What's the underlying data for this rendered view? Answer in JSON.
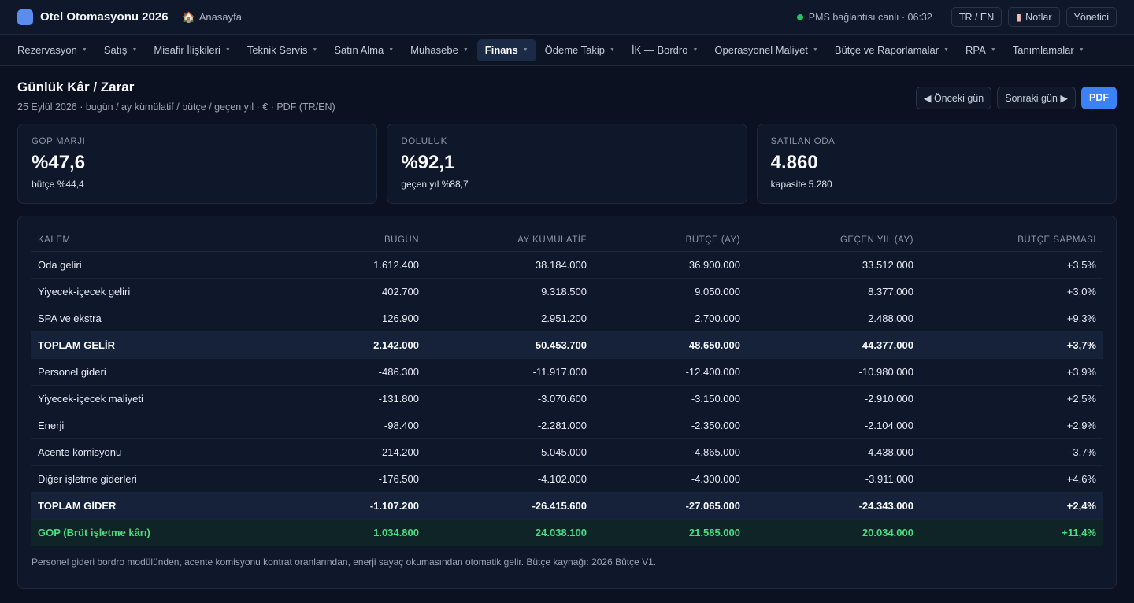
{
  "app": {
    "title": "Otel Otomasyonu 2026",
    "home": "Anasayfa",
    "status": "PMS bağlantısı canlı · 06:32",
    "lang": "TR / EN",
    "notes": "Notlar",
    "user": "Yönetici",
    "accent": "#3b82f6",
    "status_color": "#22c55e"
  },
  "nav": [
    {
      "label": "Rezervasyon"
    },
    {
      "label": "Satış"
    },
    {
      "label": "Misafir İlişkileri"
    },
    {
      "label": "Teknik Servis"
    },
    {
      "label": "Satın Alma"
    },
    {
      "label": "Muhasebe"
    },
    {
      "label": "Finans"
    },
    {
      "label": "Ödeme Takip"
    },
    {
      "label": "İK — Bordro"
    },
    {
      "label": "Operasyonel Maliyet"
    },
    {
      "label": "Bütçe ve Raporlamalar"
    },
    {
      "label": "RPA"
    },
    {
      "label": "Tanımlamalar"
    }
  ],
  "page": {
    "title": "Günlük Kâr / Zarar",
    "subtitle": "25 Eylül 2026 · bugün / ay kümülatif / bütçe / geçen yıl · € · PDF (TR/EN)",
    "prev": "◀ Önceki gün",
    "next": "Sonraki gün ▶",
    "pdf": "PDF"
  },
  "kpis": [
    {
      "label": "GOP MARJI",
      "value": "%47,6",
      "sub": "bütçe %44,4"
    },
    {
      "label": "DOLULUK",
      "value": "%92,1",
      "sub": "geçen yıl %88,7"
    },
    {
      "label": "SATILAN ODA",
      "value": "4.860",
      "sub": "kapasite 5.280"
    }
  ],
  "table": {
    "headers": [
      "KALEM",
      "BUGÜN",
      "AY KÜMÜLATİF",
      "BÜTÇE (AY)",
      "GEÇEN YIL (AY)",
      "BÜTÇE SAPMASI"
    ],
    "rows": [
      [
        "Oda geliri",
        "1.612.400",
        "38.184.000",
        "36.900.000",
        "33.512.000",
        "+3,5%"
      ],
      [
        "Yiyecek-içecek geliri",
        "402.700",
        "9.318.500",
        "9.050.000",
        "8.377.000",
        "+3,0%"
      ],
      [
        "SPA ve ekstra",
        "126.900",
        "2.951.200",
        "2.700.000",
        "2.488.000",
        "+9,3%"
      ],
      [
        "TOPLAM GELİR",
        "2.142.000",
        "50.453.700",
        "48.650.000",
        "44.377.000",
        "+3,7%"
      ],
      [
        "Personel gideri",
        "-486.300",
        "-11.917.000",
        "-12.400.000",
        "-10.980.000",
        "+3,9%"
      ],
      [
        "Yiyecek-içecek maliyeti",
        "-131.800",
        "-3.070.600",
        "-3.150.000",
        "-2.910.000",
        "+2,5%"
      ],
      [
        "Enerji",
        "-98.400",
        "-2.281.000",
        "-2.350.000",
        "-2.104.000",
        "+2,9%"
      ],
      [
        "Acente komisyonu",
        "-214.200",
        "-5.045.000",
        "-4.865.000",
        "-4.438.000",
        "-3,7%"
      ],
      [
        "Diğer işletme giderleri",
        "-176.500",
        "-4.102.000",
        "-4.300.000",
        "-3.911.000",
        "+4,6%"
      ],
      [
        "TOPLAM GİDER",
        "-1.107.200",
        "-26.415.600",
        "-27.065.000",
        "-24.343.000",
        "+2,4%"
      ],
      [
        "GOP (Brüt işletme kârı)",
        "1.034.800",
        "24.038.100",
        "21.585.000",
        "20.034.000",
        "+11,4%"
      ]
    ],
    "footnote": "Personel gideri bordro modülünden, acente komisyonu kontrat oranlarından, enerji sayaç okumasından otomatik gelir. Bütçe kaynağı: 2026 Bütçe V1."
  }
}
